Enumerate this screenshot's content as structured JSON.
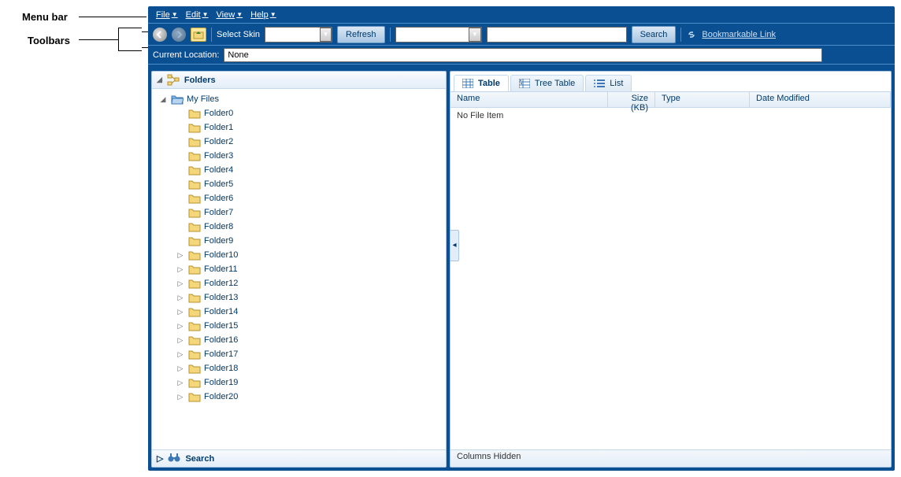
{
  "annotations": {
    "menu_bar": "Menu bar",
    "toolbars": "Toolbars"
  },
  "menubar": {
    "items": [
      "File",
      "Edit",
      "View",
      "Help"
    ]
  },
  "toolbar": {
    "select_skin_label": "Select Skin",
    "refresh_label": "Refresh",
    "search_label": "Search",
    "bookmarkable_link": "Bookmarkable Link"
  },
  "location": {
    "label": "Current Location:",
    "value": "None"
  },
  "folders_panel": {
    "title": "Folders",
    "root_label": "My Files",
    "folders": [
      {
        "label": "Folder0",
        "expandable": false
      },
      {
        "label": "Folder1",
        "expandable": false
      },
      {
        "label": "Folder2",
        "expandable": false
      },
      {
        "label": "Folder3",
        "expandable": false
      },
      {
        "label": "Folder4",
        "expandable": false
      },
      {
        "label": "Folder5",
        "expandable": false
      },
      {
        "label": "Folder6",
        "expandable": false
      },
      {
        "label": "Folder7",
        "expandable": false
      },
      {
        "label": "Folder8",
        "expandable": false
      },
      {
        "label": "Folder9",
        "expandable": false
      },
      {
        "label": "Folder10",
        "expandable": true
      },
      {
        "label": "Folder11",
        "expandable": true
      },
      {
        "label": "Folder12",
        "expandable": true
      },
      {
        "label": "Folder13",
        "expandable": true
      },
      {
        "label": "Folder14",
        "expandable": true
      },
      {
        "label": "Folder15",
        "expandable": true
      },
      {
        "label": "Folder16",
        "expandable": true
      },
      {
        "label": "Folder17",
        "expandable": true
      },
      {
        "label": "Folder18",
        "expandable": true
      },
      {
        "label": "Folder19",
        "expandable": true
      },
      {
        "label": "Folder20",
        "expandable": true
      }
    ],
    "search_label": "Search"
  },
  "tabs": {
    "table": "Table",
    "tree_table": "Tree Table",
    "list": "List"
  },
  "table": {
    "columns": [
      "Name",
      "Size (KB)",
      "Type",
      "Date Modified"
    ],
    "empty_text": "No File Item",
    "footer": "Columns Hidden"
  }
}
